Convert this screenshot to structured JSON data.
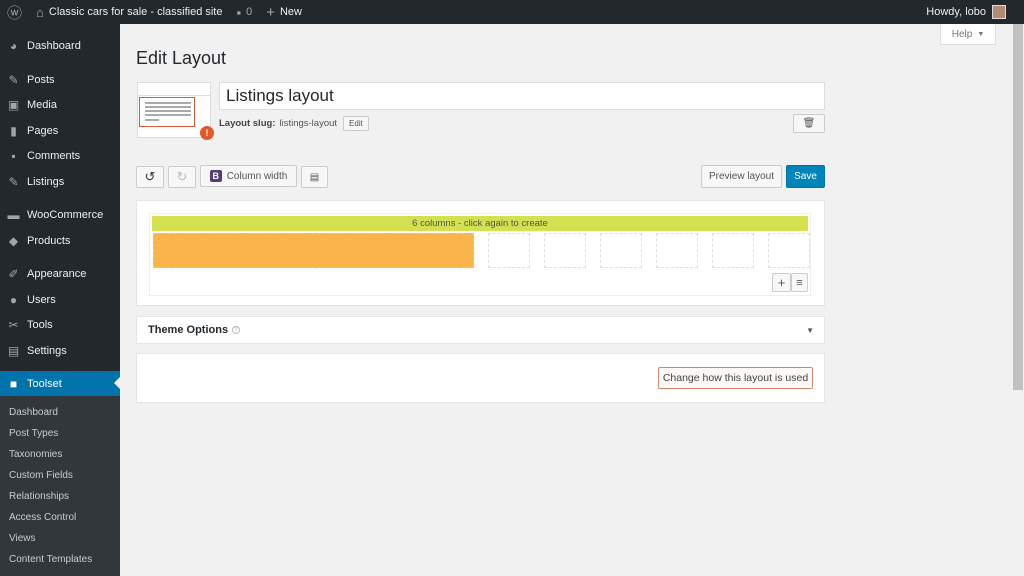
{
  "adminbar": {
    "site": "Classic cars for sale - classified site",
    "comments": "0",
    "new": "New",
    "howdy": "Howdy, lobo"
  },
  "sidebar": {
    "items": [
      "Dashboard",
      "Posts",
      "Media",
      "Pages",
      "Comments",
      "Listings",
      "WooCommerce",
      "Products",
      "Appearance",
      "Users",
      "Tools",
      "Settings",
      "Toolset"
    ],
    "submenu": [
      "Dashboard",
      "Post Types",
      "Taxonomies",
      "Custom Fields",
      "Relationships",
      "Access Control",
      "Views",
      "Content Templates"
    ]
  },
  "main": {
    "help": "Help",
    "title": "Edit Layout",
    "layout_name": "Listings layout",
    "slug_label": "Layout slug:",
    "slug": "listings-layout",
    "edit": "Edit",
    "column_width": "Column width",
    "preview": "Preview layout",
    "save": "Save",
    "grid_hint": "6 columns - click again to create",
    "theme_options": "Theme Options",
    "change_usage": "Change how this layout is used"
  },
  "colors": {
    "accent": "#0073aa",
    "save": "#0085ba",
    "bar": "#d3e150",
    "selection": "#fbb44a",
    "warning": "#e2582a"
  }
}
